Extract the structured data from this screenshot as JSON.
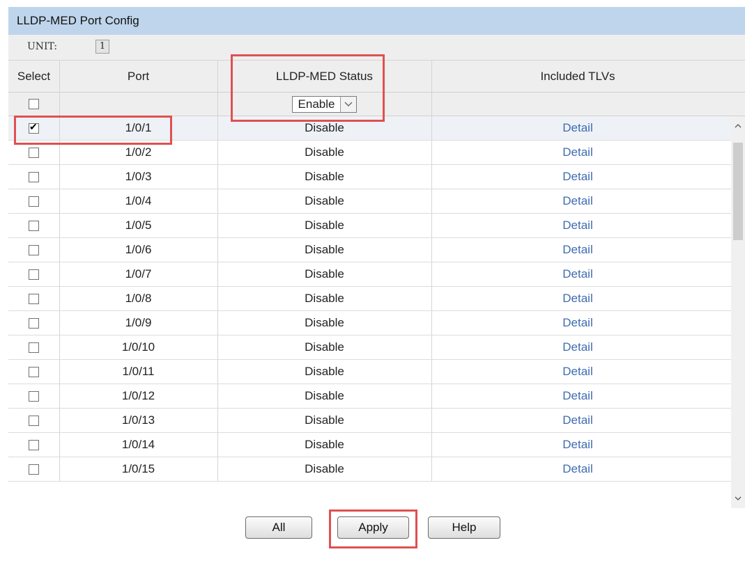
{
  "panel": {
    "title": "LLDP-MED Port Config"
  },
  "unit": {
    "label": "UNIT:",
    "value": "1"
  },
  "table": {
    "headers": {
      "select": "Select",
      "port": "Port",
      "status": "LLDP-MED Status",
      "tlvs": "Included TLVs"
    },
    "status_select": {
      "value": "Enable"
    },
    "rows": [
      {
        "port": "1/0/1",
        "status": "Disable",
        "tlvs": "Detail",
        "checked": true
      },
      {
        "port": "1/0/2",
        "status": "Disable",
        "tlvs": "Detail",
        "checked": false
      },
      {
        "port": "1/0/3",
        "status": "Disable",
        "tlvs": "Detail",
        "checked": false
      },
      {
        "port": "1/0/4",
        "status": "Disable",
        "tlvs": "Detail",
        "checked": false
      },
      {
        "port": "1/0/5",
        "status": "Disable",
        "tlvs": "Detail",
        "checked": false
      },
      {
        "port": "1/0/6",
        "status": "Disable",
        "tlvs": "Detail",
        "checked": false
      },
      {
        "port": "1/0/7",
        "status": "Disable",
        "tlvs": "Detail",
        "checked": false
      },
      {
        "port": "1/0/8",
        "status": "Disable",
        "tlvs": "Detail",
        "checked": false
      },
      {
        "port": "1/0/9",
        "status": "Disable",
        "tlvs": "Detail",
        "checked": false
      },
      {
        "port": "1/0/10",
        "status": "Disable",
        "tlvs": "Detail",
        "checked": false
      },
      {
        "port": "1/0/11",
        "status": "Disable",
        "tlvs": "Detail",
        "checked": false
      },
      {
        "port": "1/0/12",
        "status": "Disable",
        "tlvs": "Detail",
        "checked": false
      },
      {
        "port": "1/0/13",
        "status": "Disable",
        "tlvs": "Detail",
        "checked": false
      },
      {
        "port": "1/0/14",
        "status": "Disable",
        "tlvs": "Detail",
        "checked": false
      },
      {
        "port": "1/0/15",
        "status": "Disable",
        "tlvs": "Detail",
        "checked": false
      }
    ]
  },
  "buttons": {
    "all": "All",
    "apply": "Apply",
    "help": "Help"
  },
  "colors": {
    "title_bg": "#bed5ec",
    "link": "#3f6bb1",
    "highlight": "#e05050"
  }
}
